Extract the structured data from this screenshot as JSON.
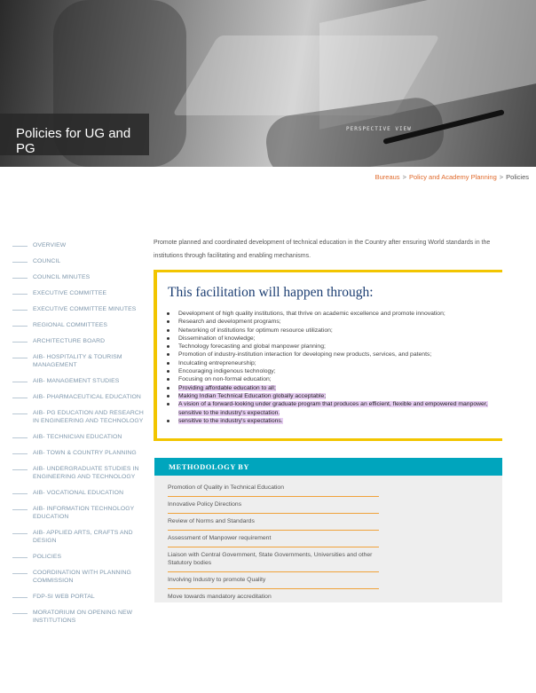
{
  "hero": {
    "title": "Policies for UG and PG",
    "screen_text": "PERSPECTIVE VIEW"
  },
  "breadcrumb": {
    "items": [
      "Bureaus",
      "Policy and Academy Planning",
      "Policies"
    ],
    "separator": ">"
  },
  "sidebar": {
    "items": [
      "OVERVIEW",
      "COUNCIL",
      "COUNCIL MINUTES",
      "EXECUTIVE COMMITTEE",
      "EXECUTIVE COMMITTEE MINUTES",
      "REGIONAL COMMITTEES",
      "ARCHITECTURE BOARD",
      "AIB- HOSPITALITY & TOURISM MANAGEMENT",
      "AIB- MANAGEMENT STUDIES",
      "AIB- PHARMACEUTICAL EDUCATION",
      "AIB- PG EDUCATION AND RESEARCH IN ENGINEERING AND TECHNOLOGY",
      "AIB- TECHNICIAN EDUCATION",
      "AIB- TOWN & COUNTRY PLANNING",
      "AIB- UNDERGRADUATE STUDIES IN ENGINEERING AND TECHNOLOGY",
      "AIB- VOCATIONAL EDUCATION",
      "AIB- INFORMATION TECHNOLOGY EDUCATION",
      "AIB- APPLIED ARTS, CRAFTS AND DESIGN",
      "POLICIES",
      "COORDINATION WITH PLANNING COMMISSION",
      "FDP-SI WEB PORTAL",
      "MORATORIUM ON OPENING NEW INSTITUTIONS"
    ]
  },
  "intro": "Promote planned and coordinated development of technical education in the Country after ensuring World standards in the institutions through facilitating and enabling mechanisms.",
  "facilitation": {
    "title": "This facilitation will happen through:",
    "items": [
      {
        "text": "Development of high quality institutions, that thrive on academic excellence and promote innovation;",
        "highlighted": false
      },
      {
        "text": "Research and development programs;",
        "highlighted": false
      },
      {
        "text": "Networking of institutions for optimum resource utilization;",
        "highlighted": false
      },
      {
        "text": "Dissemination of knowledge;",
        "highlighted": false
      },
      {
        "text": "Technology forecasting and global manpower planning;",
        "highlighted": false
      },
      {
        "text": "Promotion of industry-institution interaction for developing new products, services, and patents;",
        "highlighted": false
      },
      {
        "text": "Inculcating entrepreneurship;",
        "highlighted": false
      },
      {
        "text": "Encouraging indigenous technology;",
        "highlighted": false
      },
      {
        "text": "Focusing on non-formal education;",
        "highlighted": false
      },
      {
        "text": "Providing affordable education to all;",
        "highlighted": true
      },
      {
        "text": "Making Indian Technical Education globally acceptable;",
        "highlighted": true
      },
      {
        "text": "A vision of a forward-looking under graduate program that produces an efficient, flexible and empowered manpower, sensitive to the industry's expectation.",
        "highlighted": true
      },
      {
        "text": "sensitive to the industry's expectations.",
        "highlighted": true
      }
    ]
  },
  "methodology": {
    "heading": "METHODOLOGY BY",
    "items": [
      "Promotion of Quality in Technical Education",
      "Innovative Policy Directions",
      "Review of Norms and Standards",
      "Assessment of Manpower requirement",
      "Liaison with Central Government, State Governments, Universities and other Statutory bodies",
      "Involving Industry to promote Quality",
      "Move towards mandatory accreditation"
    ]
  },
  "colors": {
    "accent_orange": "#e06a2b",
    "facilitation_border": "#f2c500",
    "methodology_header": "#00a5bd",
    "highlight": "#e7cff2",
    "sidebar_text": "#7d96ab"
  }
}
